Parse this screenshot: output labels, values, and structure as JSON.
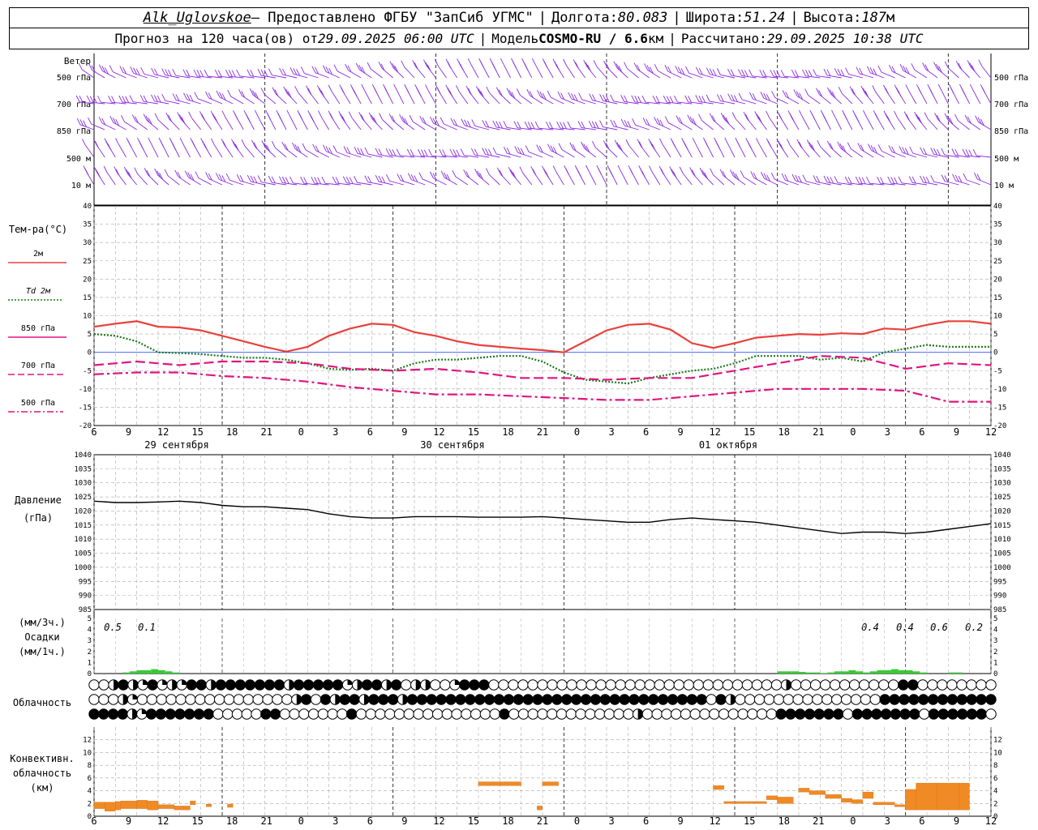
{
  "header": {
    "station": "Alk_Uglovskoe",
    "provider": " – Предоставлено ФГБУ \"ЗапСиб УГМС\" ",
    "lon_label": "Долгота: ",
    "lon_value": "80.083",
    "lat_label": "Широта: ",
    "lat_value": "51.24",
    "alt_label": "Высота: ",
    "alt_value": "187",
    "alt_unit": "м",
    "forecast_label": "Прогноз на 120 часа(ов) от ",
    "forecast_from": "29.09.2025 06:00 UTC",
    "model_label": "Модель ",
    "model_name": "COSMO-RU / 6.6",
    "model_unit": "км",
    "calc_label": "Рассчитано: ",
    "calc_time": "29.09.2025 10:38 UTC"
  },
  "wind_panel": {
    "title": "Ветер",
    "levels": [
      "500 гПа",
      "700 гПа",
      "850 гПа",
      "500 м",
      "10 м"
    ],
    "color": "#8a2be2"
  },
  "temp_panel": {
    "title": "Тем-ра(°C)",
    "legend": [
      {
        "label": "2м",
        "color": "#e8413c",
        "style": "solid"
      },
      {
        "label": "Td 2м",
        "color": "#1a7a1a",
        "style": "dotted"
      },
      {
        "label": "850 гПа",
        "color": "#e0157e",
        "style": "solid"
      },
      {
        "label": "700 гПа",
        "color": "#e0157e",
        "style": "dash"
      },
      {
        "label": "500 гПа",
        "color": "#e0157e",
        "style": "dashdot"
      }
    ]
  },
  "pressure_panel": {
    "title": "Давление",
    "unit": "(гПа)"
  },
  "precip_panel": {
    "unit3": "(мм/3ч.)",
    "title": "Осадки",
    "unit1": "(мм/1ч.)",
    "totals": [
      "0.5",
      "0.1",
      "0.4",
      "0.4",
      "0.6",
      "0.2"
    ],
    "color": "#33cc33"
  },
  "cloud_panel": {
    "title": "Облачность"
  },
  "conv_panel": {
    "title1": "Конвективн.",
    "title2": "облачность",
    "unit": "(км)",
    "color": "#f08a24"
  },
  "time_axis": {
    "hour_labels": [
      "6",
      "9",
      "12",
      "15",
      "18",
      "21",
      "0",
      "3",
      "6",
      "9",
      "12",
      "15",
      "18",
      "21",
      "0",
      "3",
      "6",
      "9",
      "12",
      "15",
      "18",
      "21",
      "0",
      "3",
      "6",
      "9",
      "12"
    ],
    "dates": [
      "29 сентября",
      "30 сентября",
      "01 октября"
    ]
  },
  "chart_data": [
    {
      "type": "line",
      "title": "Тем-ра(°C)",
      "x_unit": "hours from 29.09 06 UTC",
      "ylim": [
        -20,
        40
      ],
      "yticks": [
        40,
        35,
        30,
        25,
        20,
        15,
        10,
        5,
        0,
        -5,
        -10,
        -15,
        -20
      ],
      "series": [
        {
          "name": "2м",
          "x": [
            0,
            3,
            6,
            9,
            12,
            15,
            18,
            21,
            24,
            27,
            30,
            33,
            36,
            39,
            42,
            45,
            48,
            51,
            54,
            57,
            60,
            63,
            66,
            69,
            72,
            75,
            78,
            81,
            84,
            87,
            90,
            93,
            96,
            99,
            102,
            105,
            108,
            111,
            114,
            117,
            120,
            123,
            126
          ],
          "values": [
            7,
            7.8,
            8.5,
            7,
            6.8,
            6,
            4.5,
            3,
            1.5,
            0.2,
            1.5,
            4.5,
            6.5,
            7.8,
            7.5,
            5.5,
            4.5,
            3,
            2,
            1.5,
            1,
            0.6,
            0,
            3,
            6,
            7.5,
            7.8,
            6.2,
            2.5,
            1.2,
            2.5,
            4,
            4.5,
            5,
            4.8,
            5.2,
            5,
            6.5,
            6.2,
            7.5,
            8.5,
            8.5,
            7.8
          ]
        },
        {
          "name": "Td 2м",
          "x": [
            0,
            3,
            6,
            9,
            12,
            15,
            18,
            21,
            24,
            27,
            30,
            33,
            36,
            39,
            42,
            45,
            48,
            51,
            54,
            57,
            60,
            63,
            66,
            69,
            72,
            75,
            78,
            81,
            84,
            87,
            90,
            93,
            96,
            99,
            102,
            105,
            108,
            111,
            114,
            117,
            120,
            123,
            126
          ],
          "values": [
            5,
            4.5,
            3,
            0,
            -0.2,
            -0.5,
            -1,
            -1.5,
            -1.5,
            -2,
            -3,
            -4.5,
            -4.8,
            -4.5,
            -5,
            -3,
            -2,
            -2,
            -1.5,
            -1,
            -1,
            -2.5,
            -5.5,
            -7.5,
            -8,
            -8.5,
            -7,
            -6,
            -5,
            -4.5,
            -3,
            -1,
            -1,
            -1,
            -2,
            -1.5,
            -2.5,
            0,
            1,
            2,
            1.5,
            1.5,
            1.5
          ]
        },
        {
          "name": "850 гПа",
          "x": [
            0,
            6,
            12,
            18,
            24,
            30,
            36,
            42,
            48,
            54,
            60,
            66,
            72,
            78,
            84,
            90,
            96,
            102,
            108,
            114,
            120,
            126
          ],
          "values": [
            -3.5,
            -2.5,
            -3.5,
            -2.5,
            -2.5,
            -3,
            -4.5,
            -5,
            -4.5,
            -5.5,
            -7,
            -7,
            -7.5,
            -7,
            -7,
            -5,
            -3,
            -1,
            -1.5,
            -4.5,
            -3,
            -3.5
          ]
        },
        {
          "name": "700 гПа",
          "x": [
            0,
            6,
            12,
            18,
            24,
            30,
            36,
            42,
            48,
            54,
            60,
            66,
            72,
            78,
            84,
            90,
            96,
            102,
            108,
            114,
            120,
            126
          ],
          "values": [
            -3.5,
            -2.5,
            -3.5,
            -2.5,
            -2.5,
            -3,
            -4.5,
            -5,
            -4.5,
            -5.5,
            -7,
            -7,
            -7.5,
            -7,
            -7,
            -5,
            -3,
            -1,
            -1.5,
            -4.5,
            -3,
            -3.5
          ]
        },
        {
          "name": "500 гПа",
          "x": [
            0,
            6,
            12,
            18,
            24,
            30,
            36,
            42,
            48,
            54,
            60,
            66,
            72,
            78,
            84,
            90,
            96,
            102,
            108,
            114,
            120,
            126
          ],
          "values": [
            -6,
            -5.5,
            -5.5,
            -6.5,
            -7,
            -8,
            -9.5,
            -10.5,
            -11.5,
            -11.5,
            -12,
            -12.5,
            -13,
            -13,
            -12,
            -11,
            -10,
            -10,
            -10,
            -10.5,
            -13.5,
            -13.5
          ]
        }
      ]
    },
    {
      "type": "line",
      "title": "Давление",
      "ylabel": "(гПа)",
      "ylim": [
        985,
        1040
      ],
      "yticks": [
        1040,
        1035,
        1030,
        1025,
        1020,
        1015,
        1010,
        1005,
        1000,
        995,
        990,
        985
      ],
      "series": [
        {
          "name": "",
          "x": [
            0,
            3,
            6,
            9,
            12,
            15,
            18,
            21,
            24,
            27,
            30,
            33,
            36,
            39,
            42,
            45,
            48,
            51,
            54,
            57,
            60,
            63,
            66,
            69,
            72,
            75,
            78,
            81,
            84,
            87,
            90,
            93,
            96,
            99,
            102,
            105,
            108,
            111,
            114,
            117,
            120,
            123,
            126
          ],
          "values": [
            1023.5,
            1023,
            1023,
            1023.2,
            1023.5,
            1023,
            1022,
            1021.5,
            1021.5,
            1021,
            1020.5,
            1019,
            1018,
            1017.5,
            1017.5,
            1018,
            1018,
            1018,
            1017.8,
            1017.8,
            1017.8,
            1018,
            1017.5,
            1017,
            1016.5,
            1016,
            1016,
            1017,
            1017.5,
            1017,
            1016.5,
            1016,
            1015,
            1014,
            1013,
            1012,
            1012.5,
            1012.5,
            1012,
            1012.5,
            1013.5,
            1014.5,
            1015.5
          ]
        }
      ]
    },
    {
      "type": "bar",
      "title": "Осадки",
      "ylabel": "(мм/1ч.)",
      "ylim": [
        0,
        5
      ],
      "yticks": [
        5,
        4,
        3,
        2,
        1,
        0
      ],
      "hours": [
        0,
        1,
        2,
        3,
        4,
        5,
        6,
        7,
        8,
        9,
        10,
        11,
        12,
        13,
        14,
        15,
        16,
        17,
        18,
        19,
        20,
        21,
        22,
        23,
        24,
        25,
        26,
        27,
        28,
        29,
        30,
        31,
        32,
        33,
        34,
        35,
        36,
        37,
        38,
        39,
        40,
        41,
        42,
        43,
        44,
        45,
        46,
        47,
        48,
        49,
        50,
        51,
        52,
        53,
        54,
        55,
        56,
        57,
        58,
        59,
        60,
        61,
        62,
        63,
        64,
        65,
        66,
        67,
        68,
        69,
        70,
        71,
        72,
        73,
        74,
        75,
        76,
        77,
        78,
        79,
        80,
        81,
        82,
        83,
        84,
        85,
        86,
        87,
        88,
        89,
        90,
        91,
        92,
        93,
        94,
        95,
        96,
        97,
        98,
        99,
        100,
        101,
        102,
        103,
        104,
        105,
        106,
        107,
        108,
        109,
        110,
        111,
        112,
        113,
        114,
        115,
        116,
        117,
        118,
        119,
        120,
        121,
        122,
        123,
        124,
        125,
        126
      ],
      "values": [
        0,
        0,
        0,
        0,
        0.1,
        0.2,
        0.3,
        0.3,
        0.4,
        0.3,
        0.2,
        0.1,
        0,
        0,
        0,
        0,
        0,
        0,
        0,
        0,
        0,
        0,
        0,
        0,
        0,
        0,
        0,
        0,
        0,
        0,
        0,
        0,
        0,
        0,
        0,
        0,
        0,
        0,
        0,
        0,
        0,
        0,
        0,
        0,
        0,
        0,
        0,
        0,
        0,
        0,
        0,
        0,
        0,
        0,
        0,
        0,
        0,
        0,
        0,
        0,
        0,
        0,
        0,
        0,
        0,
        0,
        0,
        0,
        0,
        0,
        0,
        0,
        0,
        0,
        0,
        0,
        0,
        0,
        0,
        0,
        0,
        0,
        0,
        0,
        0,
        0,
        0,
        0,
        0,
        0,
        0,
        0,
        0,
        0,
        0,
        0,
        0.2,
        0.2,
        0.2,
        0.15,
        0.1,
        0.1,
        0.05,
        0.1,
        0.2,
        0.2,
        0.3,
        0.2,
        0.1,
        0.2,
        0.3,
        0.3,
        0.4,
        0.3,
        0.3,
        0.2,
        0.1,
        0,
        0,
        0,
        0.1,
        0.1,
        0
      ]
    },
    {
      "type": "bar",
      "title": "Конвективн. облачность",
      "ylabel": "(км)",
      "ylim": [
        0,
        14
      ],
      "yticks": [
        12,
        10,
        8,
        6,
        4,
        2,
        0
      ],
      "segments": [
        [
          0,
          2,
          1.2,
          2.2
        ],
        [
          2,
          4,
          0.8,
          2.2
        ],
        [
          4,
          5,
          1.0,
          2.3
        ],
        [
          5,
          8,
          1.2,
          2.4
        ],
        [
          8,
          10,
          1.2,
          2.5
        ],
        [
          10,
          12,
          1.0,
          2.4
        ],
        [
          12,
          15,
          1.2,
          1.8
        ],
        [
          15,
          18,
          1.0,
          1.6
        ],
        [
          18,
          19,
          1.8,
          2.4
        ],
        [
          21,
          22,
          1.5,
          1.9
        ],
        [
          25,
          26,
          1.4,
          1.9
        ],
        [
          72,
          76,
          4.8,
          5.4
        ],
        [
          76,
          80,
          4.8,
          5.4
        ],
        [
          83,
          84,
          1.0,
          1.6
        ],
        [
          84,
          87,
          4.8,
          5.4
        ],
        [
          116,
          118,
          4.2,
          4.8
        ],
        [
          118,
          126,
          2.0,
          2.3
        ],
        [
          126,
          128,
          2.6,
          3.2
        ],
        [
          128,
          131,
          2.0,
          3.0
        ],
        [
          132,
          134,
          3.8,
          4.4
        ],
        [
          134,
          137,
          3.4,
          4.0
        ],
        [
          137,
          140,
          2.8,
          3.4
        ],
        [
          140,
          142,
          2.2,
          2.8
        ],
        [
          142,
          144,
          2.0,
          2.6
        ],
        [
          144,
          146,
          2.8,
          3.8
        ],
        [
          146,
          150,
          1.8,
          2.2
        ],
        [
          150,
          152,
          1.5,
          1.8
        ],
        [
          152,
          154,
          1.0,
          4.2
        ],
        [
          154,
          158,
          1.0,
          5.2
        ],
        [
          158,
          162,
          1.0,
          5.2
        ],
        [
          162,
          164,
          1.0,
          5.2
        ]
      ]
    }
  ],
  "cloud_rows": {
    "high": "llmfmsfsmsffmfffffffmfffffsmffmflmmllsfffllllllllllllllllllllllllllllllmlllllllllllffllllllll",
    "mid": "lllmsllllllllllllllllmflfmffmfffmffffffffffffffffffffffffffffffflfmlllllllllllllllffffffffffff",
    "low": "ffffmsffffffflllllfflllllllflllllllllllllllflllllllllllllmllllllllllllllffffffflffffffflffffffl"
  }
}
